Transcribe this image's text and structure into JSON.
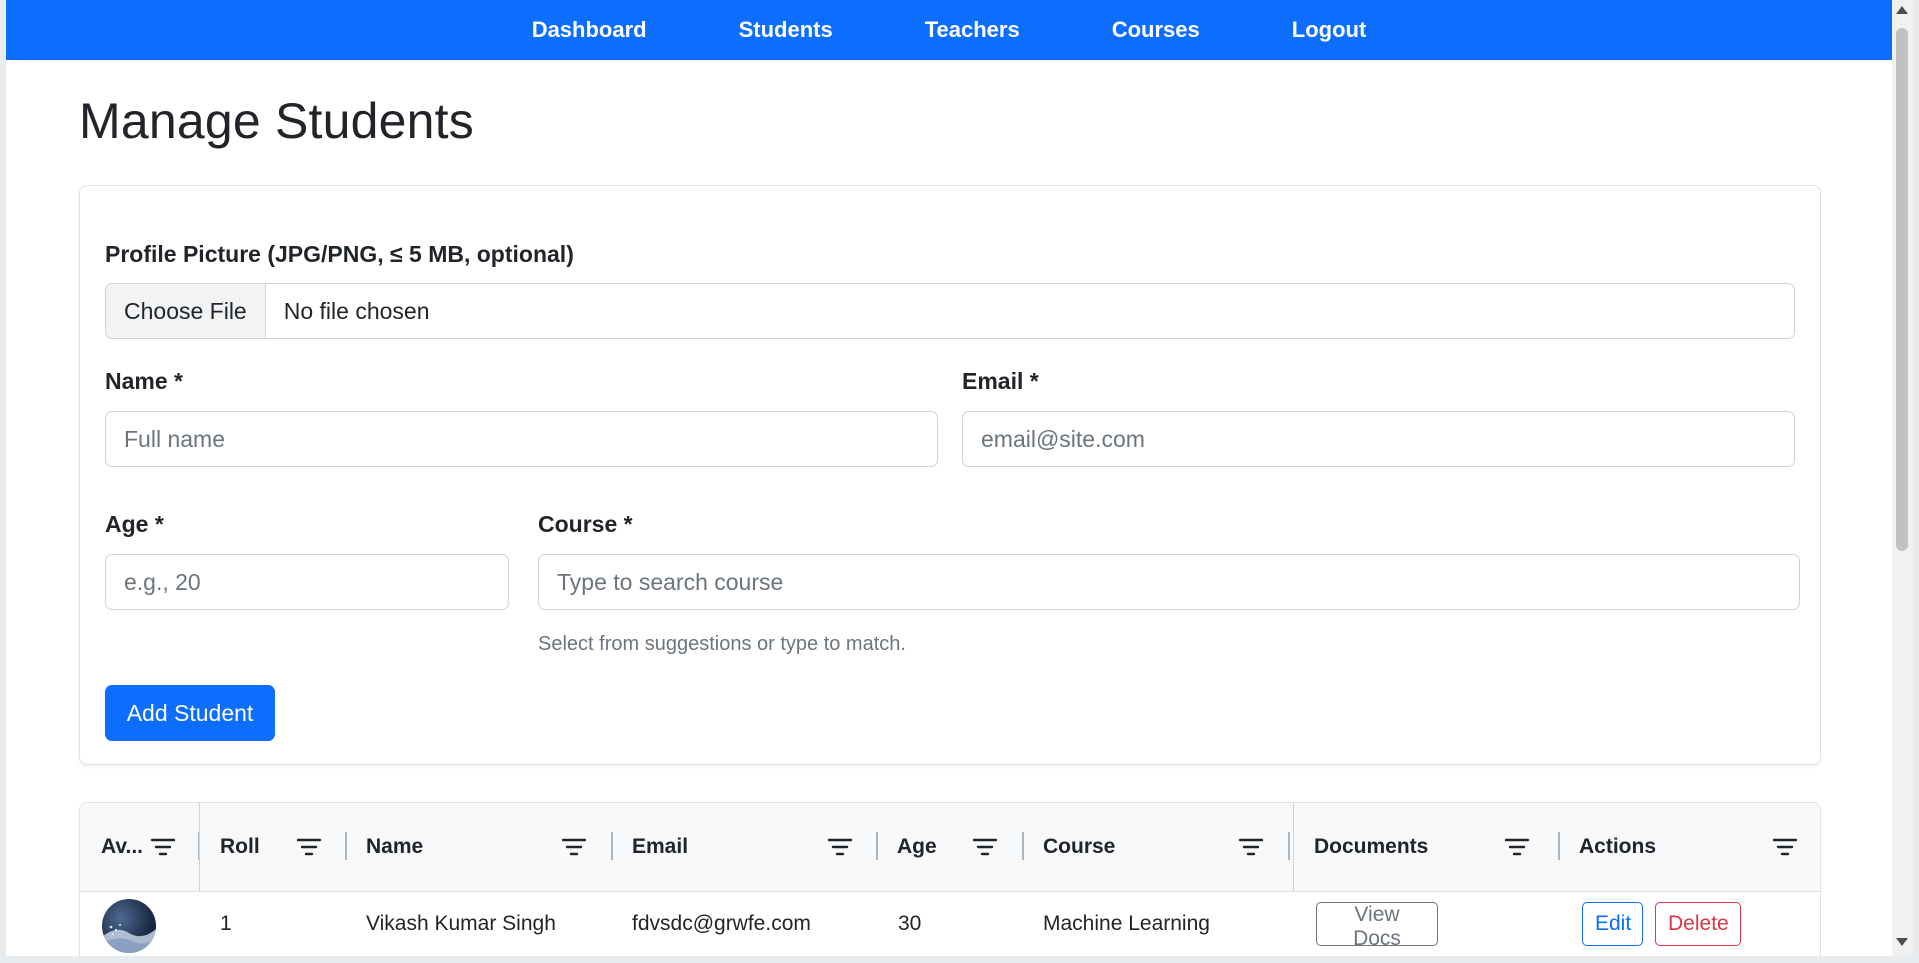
{
  "nav": {
    "items": [
      {
        "label": "Dashboard"
      },
      {
        "label": "Students"
      },
      {
        "label": "Teachers"
      },
      {
        "label": "Courses"
      },
      {
        "label": "Logout"
      }
    ]
  },
  "page": {
    "title": "Manage Students"
  },
  "form": {
    "profile_label": "Profile Picture (JPG/PNG, ≤ 5 MB, optional)",
    "file_button": "Choose File",
    "file_status": "No file chosen",
    "name_label": "Name *",
    "name_placeholder": "Full name",
    "email_label": "Email *",
    "email_placeholder": "email@site.com",
    "age_label": "Age *",
    "age_placeholder": "e.g., 20",
    "course_label": "Course *",
    "course_placeholder": "Type to search course",
    "course_help": "Select from suggestions or type to match.",
    "submit_label": "Add Student"
  },
  "table": {
    "headers": [
      "Av...",
      "Roll",
      "Name",
      "Email",
      "Age",
      "Course",
      "Documents",
      "Actions"
    ],
    "rows": [
      {
        "avatar_icon": "avatar-photo",
        "roll": "1",
        "name": "Vikash Kumar Singh",
        "email": "fdvsdc@grwfe.com",
        "age": "30",
        "course": "Machine Learning",
        "documents_label": "View Docs",
        "edit_label": "Edit",
        "delete_label": "Delete"
      }
    ]
  },
  "colors": {
    "primary": "#0d6efd",
    "danger": "#dc3545",
    "secondary": "#6c757d"
  },
  "icons": {
    "filter": "filter-icon"
  }
}
